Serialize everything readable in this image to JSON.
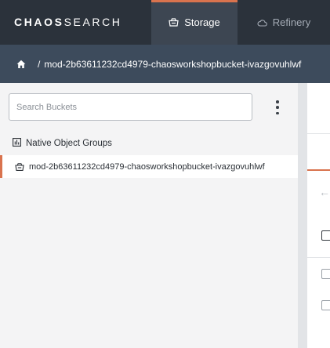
{
  "header": {
    "logo_part1": "CHAOS",
    "logo_part2": "SEARCH",
    "tabs": [
      {
        "label": "Storage",
        "icon": "storage-icon",
        "active": true
      },
      {
        "label": "Refinery",
        "icon": "cloud-icon",
        "active": false
      }
    ]
  },
  "breadcrumb": {
    "home_icon": "home-icon",
    "separator": "/",
    "path": "mod-2b63611232cd4979-chaosworkshopbucket-ivazgovuhlwf"
  },
  "sidebar": {
    "search": {
      "placeholder": "Search Buckets",
      "value": ""
    },
    "menu_icon": "kebab-menu-icon",
    "group_heading": "Native Object Groups",
    "group_icon": "chart-icon",
    "buckets": [
      {
        "name": "mod-2b63611232cd4979-chaosworkshopbucket-ivazgovuhlwf",
        "icon": "bucket-icon",
        "selected": true
      }
    ]
  },
  "colors": {
    "topbar": "#2b323b",
    "active_tab": "#3d4652",
    "breadcrumb_bar": "#3d4b5c",
    "accent": "#d9734e",
    "sidebar_bg": "#f4f4f5"
  }
}
